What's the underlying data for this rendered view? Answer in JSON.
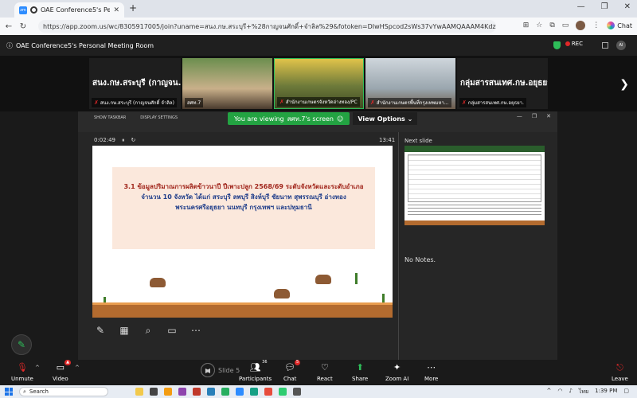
{
  "browser": {
    "tab_title": "OAE Conference5's Personal M",
    "tab_favicon_text": "zm",
    "url": "https://app.zoom.us/wc/8305917005/join?uname=สนง.กษ.สระบุรี+%28กาญจนศักดิ์+จำลิล%29&fotoken=DIwHSpcod2sWs37vYwAAMQAAAM4KdzPKKgW1FGutLpH...",
    "chat_label": "Chat"
  },
  "meeting": {
    "title": "OAE Conference5's Personal Meeting Room",
    "rec_label": "REC",
    "participants_tiles": [
      {
        "name": "สนง.กษ.สระบุรี (กาญจนศักดิ์ จำลิล)",
        "big": "สนง.กษ.สระบุรี (กาญจน..."
      },
      {
        "name": "สศท.7"
      },
      {
        "name": "สำนักงานเกษตรจังหวัดอ่างทอง/PC"
      },
      {
        "name": "สำนักงานเกษตรพื้นที่กรุงเทพมหา..."
      },
      {
        "name": "กลุ่มสารสนเทศ.กษ.อยุธยา.",
        "big": "กลุ่มสารสนเทศ.กษ.อยุธยา."
      }
    ],
    "viewing_text": "You are viewing",
    "viewing_name": "สศท.7's screen",
    "view_options": "View Options",
    "show_taskbar": "SHOW TASKBAR",
    "display_settings": "DISPLAY SETTINGS"
  },
  "presenter": {
    "elapsed": "0:02:49",
    "clock": "13:41",
    "next_slide_label": "Next slide",
    "no_notes": "No Notes.",
    "slide_line1": "3.1 ข้อมูลปริมาณการผลิตข้าวนาปี ปีเพาะปลูก 2568/69 ระดับจังหวัดและระดับอำเภอ",
    "slide_line2": "จำนวน 10 จังหวัด ได้แก่ สระบุรี ลพบุรี สิงห์บุรี ชัยนาท สุพรรณบุรี อ่างทอง",
    "slide_line3": "พระนครศรีอยุธยา นนทบุรี กรุงเทพฯ และปทุมธานี"
  },
  "toolbar": {
    "unmute": "Unmute",
    "video": "Video",
    "slide_counter": "Slide 5",
    "participants": "Participants",
    "participants_count": "36",
    "chat": "Chat",
    "chat_badge": "5",
    "react": "React",
    "share": "Share",
    "zoom_ai": "Zoom AI",
    "more": "More",
    "leave": "Leave"
  },
  "taskbar": {
    "search": "Search",
    "lang": "ไทย",
    "time": "1:39 PM"
  },
  "colors": {
    "accent_green": "#23a342",
    "zoom_blue": "#2d8cff",
    "rec_red": "#e02828"
  }
}
